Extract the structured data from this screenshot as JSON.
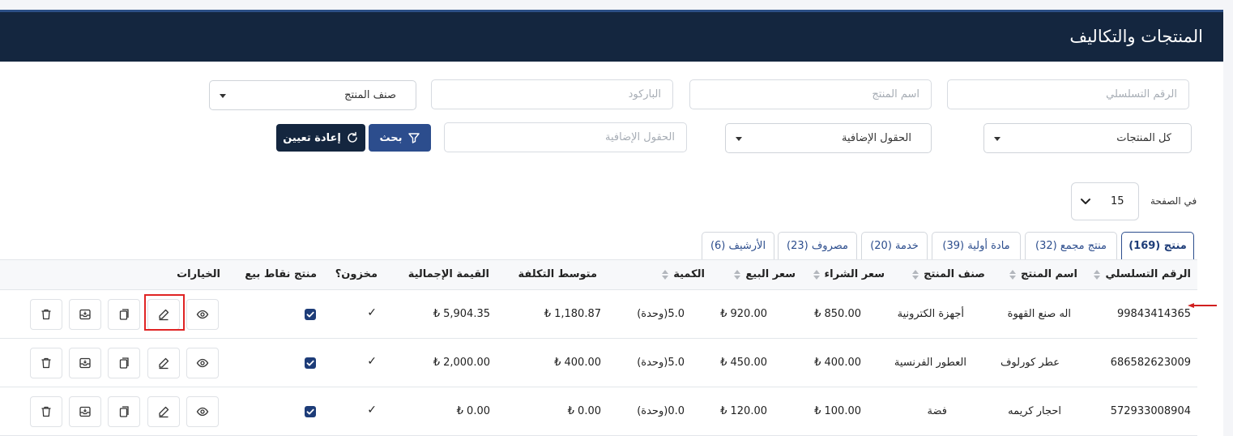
{
  "header": {
    "title": "المنتجات والتكاليف"
  },
  "filters": {
    "serial_placeholder": "الرقم التسلسلي",
    "name_placeholder": "اسم المنتج",
    "barcode_placeholder": "الباركود",
    "category_select": "صنف المنتج",
    "products_select": "كل المنتجات",
    "extra_fields_select": "الحقول الإضافية",
    "extra_fields_placeholder": "الحقول الإضافية",
    "search_label": "بحث",
    "reset_label": "إعادة تعيين"
  },
  "pagination": {
    "label": "في الصفحة",
    "value": "15"
  },
  "tabs": [
    {
      "label": "منتج (169)"
    },
    {
      "label": "منتج مجمع (32)"
    },
    {
      "label": "مادة أولية (39)"
    },
    {
      "label": "خدمة (20)"
    },
    {
      "label": "مصروف (23)"
    },
    {
      "label": "الأرشيف (6)"
    }
  ],
  "columns": {
    "serial": "الرقم التسلسلي",
    "name": "اسم المنتج",
    "category": "صنف المنتج",
    "purchase_price": "سعر الشراء",
    "sale_price": "سعر البيع",
    "quantity": "الكمية",
    "avg_cost": "متوسط التكلفة",
    "total_value": "القيمة الإجمالية",
    "stored": "مخزون؟",
    "pos_product": "منتج نقاط بيع",
    "options": "الخيارات"
  },
  "rows": [
    {
      "serial": "99843414365",
      "name": "اله صنع القهوة",
      "category": "أجهزة الكترونية",
      "purchase_price": "850.00 ₺",
      "sale_price": "920.00 ₺",
      "quantity": "5.0(وحدة)",
      "avg_cost": "1,180.87 ₺",
      "total_value": "5,904.35 ₺",
      "stored": "✓"
    },
    {
      "serial": "686582623009",
      "name": "عطر كورلوف",
      "category": "العطور الفرنسية",
      "purchase_price": "400.00 ₺",
      "sale_price": "450.00 ₺",
      "quantity": "5.0(وحدة)",
      "avg_cost": "400.00 ₺",
      "total_value": "2,000.00 ₺",
      "stored": "✓"
    },
    {
      "serial": "572933008904",
      "name": "احجار كريمه",
      "category": "فضة",
      "purchase_price": "100.00 ₺",
      "sale_price": "120.00 ₺",
      "quantity": "0.0(وحدة)",
      "avg_cost": "0.00 ₺",
      "total_value": "0.00 ₺",
      "stored": "✓"
    }
  ],
  "colors": {
    "header_bg": "#14263f",
    "accent": "#2c4d8d",
    "highlight": "#e02424"
  },
  "icons": [
    "view-icon",
    "edit-icon",
    "copy-icon",
    "archive-icon",
    "delete-icon",
    "filter-icon",
    "reset-icon",
    "chevron-down-icon",
    "checkbox-icon"
  ]
}
